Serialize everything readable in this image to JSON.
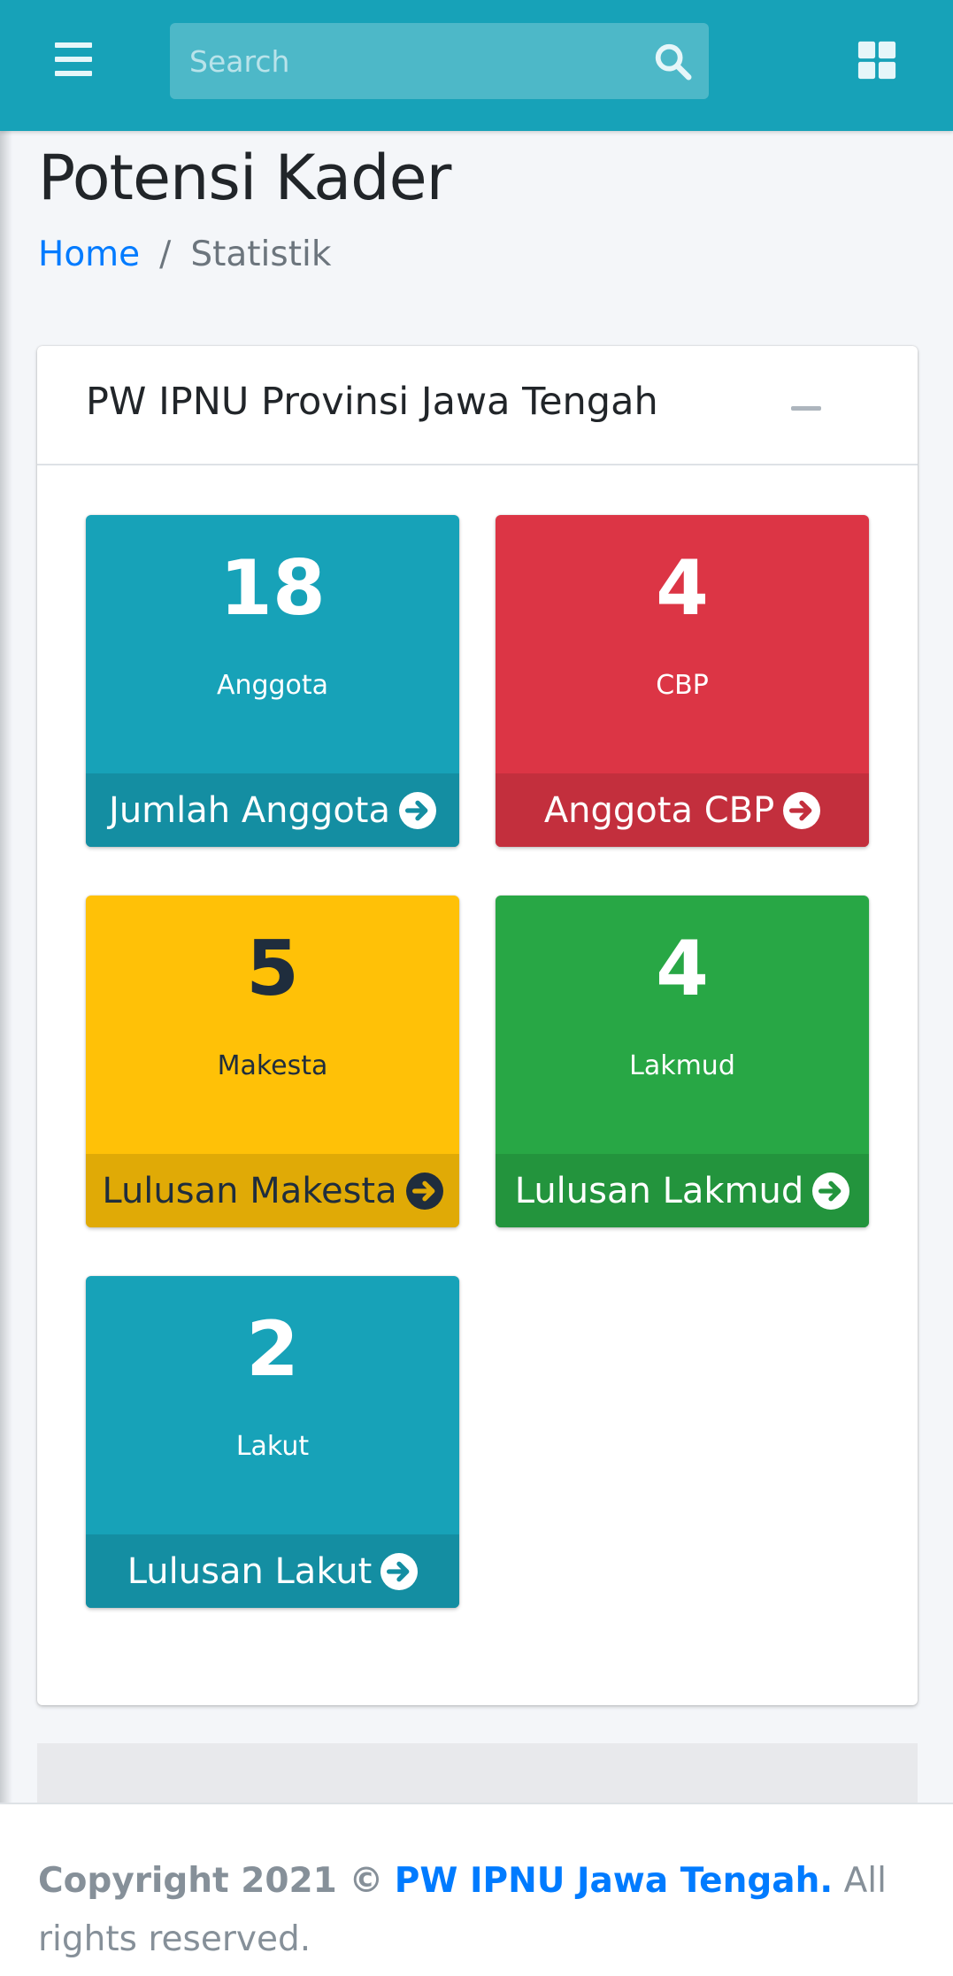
{
  "navbar": {
    "menu_icon": "hamburger-icon",
    "search": {
      "placeholder": "Search",
      "value": "",
      "icon": "search-icon"
    },
    "apps_icon": "grid-apps-icon",
    "color": "#17a2b8"
  },
  "page": {
    "title": "Potensi Kader",
    "breadcrumb": [
      {
        "label": "Home",
        "link": true
      },
      {
        "label": "/",
        "separator": true
      },
      {
        "label": "Statistik",
        "link": false
      }
    ]
  },
  "card": {
    "title": "PW IPNU Provinsi Jawa Tengah",
    "collapse_icon": "minus-icon",
    "boxes": [
      {
        "number": "18",
        "label": "Anggota",
        "footer": "Jumlah Anggota",
        "color": "#17a2b8",
        "icon": "arrow-circle-right-icon"
      },
      {
        "number": "4",
        "label": "CBP",
        "footer": "Anggota CBP",
        "color": "#dc3545",
        "icon": "arrow-circle-right-icon"
      },
      {
        "number": "5",
        "label": "Makesta",
        "footer": "Lulusan Makesta",
        "color": "#ffc107",
        "icon": "arrow-circle-right-icon"
      },
      {
        "number": "4",
        "label": "Lakmud",
        "footer": "Lulusan Lakmud",
        "color": "#28a745",
        "icon": "arrow-circle-right-icon"
      },
      {
        "number": "2",
        "label": "Lakut",
        "footer": "Lulusan Lakut",
        "color": "#17a2b8",
        "icon": "arrow-circle-right-icon"
      }
    ]
  },
  "footer": {
    "copyright": "Copyright 2021 ©",
    "org_link": "PW IPNU Jawa Tengah.",
    "rights": "All rights reserved."
  }
}
